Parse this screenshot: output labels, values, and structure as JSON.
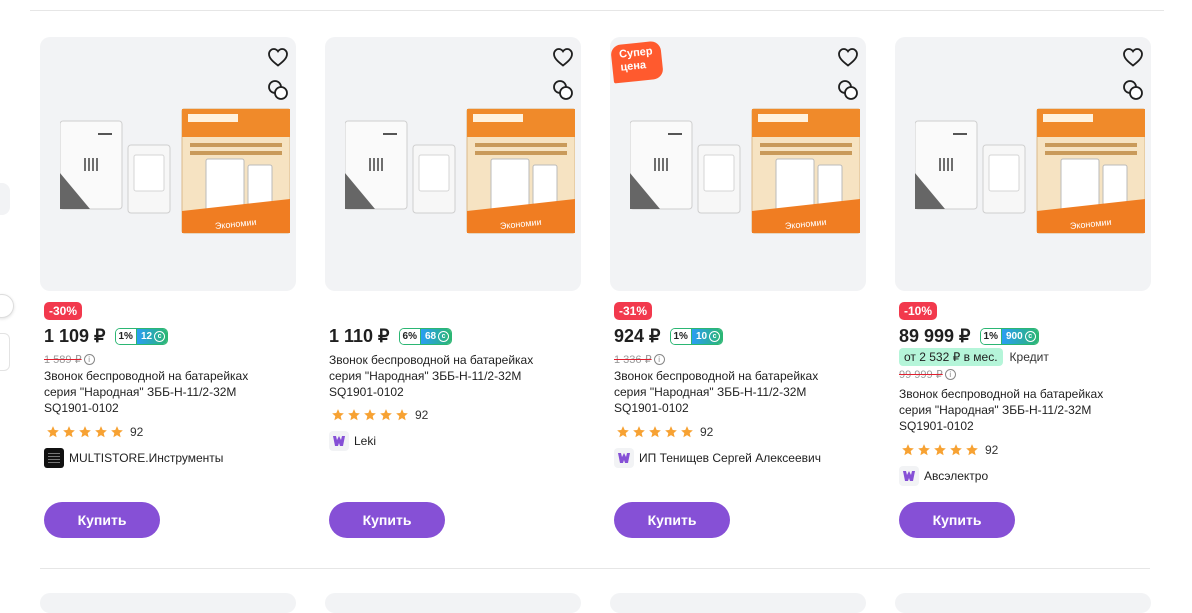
{
  "products": [
    {
      "discount": "-30%",
      "price": "1 109 ₽",
      "bonus_pct": "1%",
      "bonus_pts": "12",
      "old_price": "1 589 ₽",
      "title": "Звонок беспроводной на батарейках серия \"Народная\" ЗББ-Н-11/2-32М SQ1901-0102",
      "rating": "92",
      "seller": "MULTISTORE.Инструменты",
      "buy_label": "Купить"
    },
    {
      "price": "1 110 ₽",
      "bonus_pct": "6%",
      "bonus_pts": "68",
      "title": "Звонок беспроводной на батарейках серия \"Народная\" ЗББ-Н-11/2-32М SQ1901-0102",
      "rating": "92",
      "seller": "Leki",
      "buy_label": "Купить"
    },
    {
      "promo": "Супер цена",
      "discount": "-31%",
      "price": "924 ₽",
      "bonus_pct": "1%",
      "bonus_pts": "10",
      "old_price": "1 336 ₽",
      "title": "Звонок беспроводной на батарейках серия \"Народная\" ЗББ-Н-11/2-32М SQ1901-0102",
      "rating": "92",
      "seller": "ИП Тенищев Сергей Алексеевич",
      "buy_label": "Купить"
    },
    {
      "discount": "-10%",
      "price": "89 999 ₽",
      "bonus_pct": "1%",
      "bonus_pts": "900",
      "credit": "от 2 532 ₽ в мес.",
      "credit_label": "Кредит",
      "old_price": "99 999 ₽",
      "title": "Звонок беспроводной на батарейках серия \"Народная\" ЗББ-Н-11/2-32М SQ1901-0102",
      "rating": "92",
      "seller": "Авсэлектро",
      "buy_label": "Купить"
    }
  ],
  "package_text": "Экономии",
  "colors": {
    "buy": "#8650d6",
    "discount": "#f2394d",
    "star": "#f7a233",
    "bonus_green": "#2bb673",
    "bonus_blue": "#2a9df4"
  },
  "icons": [
    "heart-icon",
    "compare-icon",
    "star-icon",
    "info-icon",
    "seller-logo-icon"
  ]
}
